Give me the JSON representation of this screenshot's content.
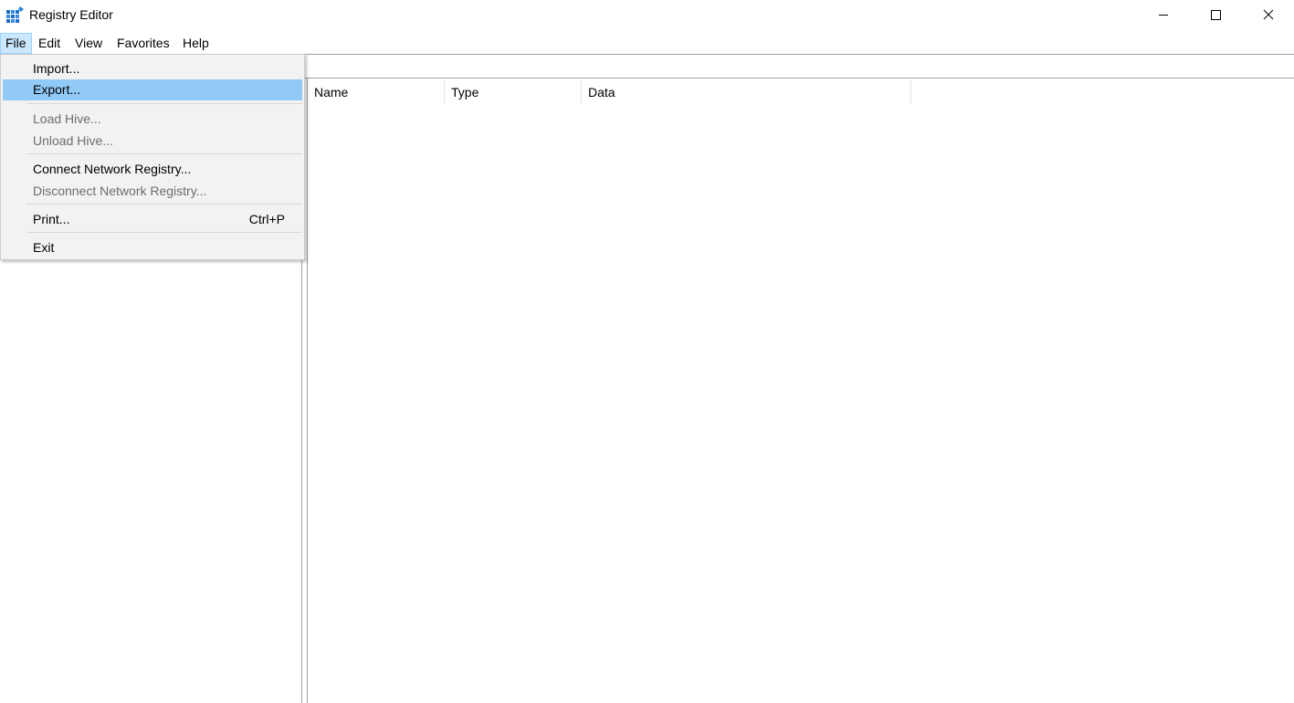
{
  "window": {
    "title": "Registry Editor",
    "icon": "registry-editor-icon",
    "controls": {
      "minimize": "minimize-icon",
      "maximize": "maximize-icon",
      "close": "close-icon"
    }
  },
  "menubar": {
    "items": [
      "File",
      "Edit",
      "View",
      "Favorites",
      "Help"
    ],
    "open_item": "File"
  },
  "file_menu": {
    "import": "Import...",
    "export": "Export...",
    "load_hive": "Load Hive...",
    "unload_hive": "Unload Hive...",
    "connect": "Connect Network Registry...",
    "disconnect": "Disconnect Network Registry...",
    "print": "Print...",
    "print_shortcut": "Ctrl+P",
    "exit": "Exit",
    "highlighted": "Export...",
    "disabled": [
      "Load Hive...",
      "Unload Hive...",
      "Disconnect Network Registry..."
    ]
  },
  "list": {
    "columns": [
      "Name",
      "Type",
      "Data"
    ]
  },
  "colors": {
    "highlight": "#91c9f7",
    "menu_open": "#cce8ff",
    "disabled_text": "#6d6d6d",
    "menu_background": "#f2f2f2"
  }
}
